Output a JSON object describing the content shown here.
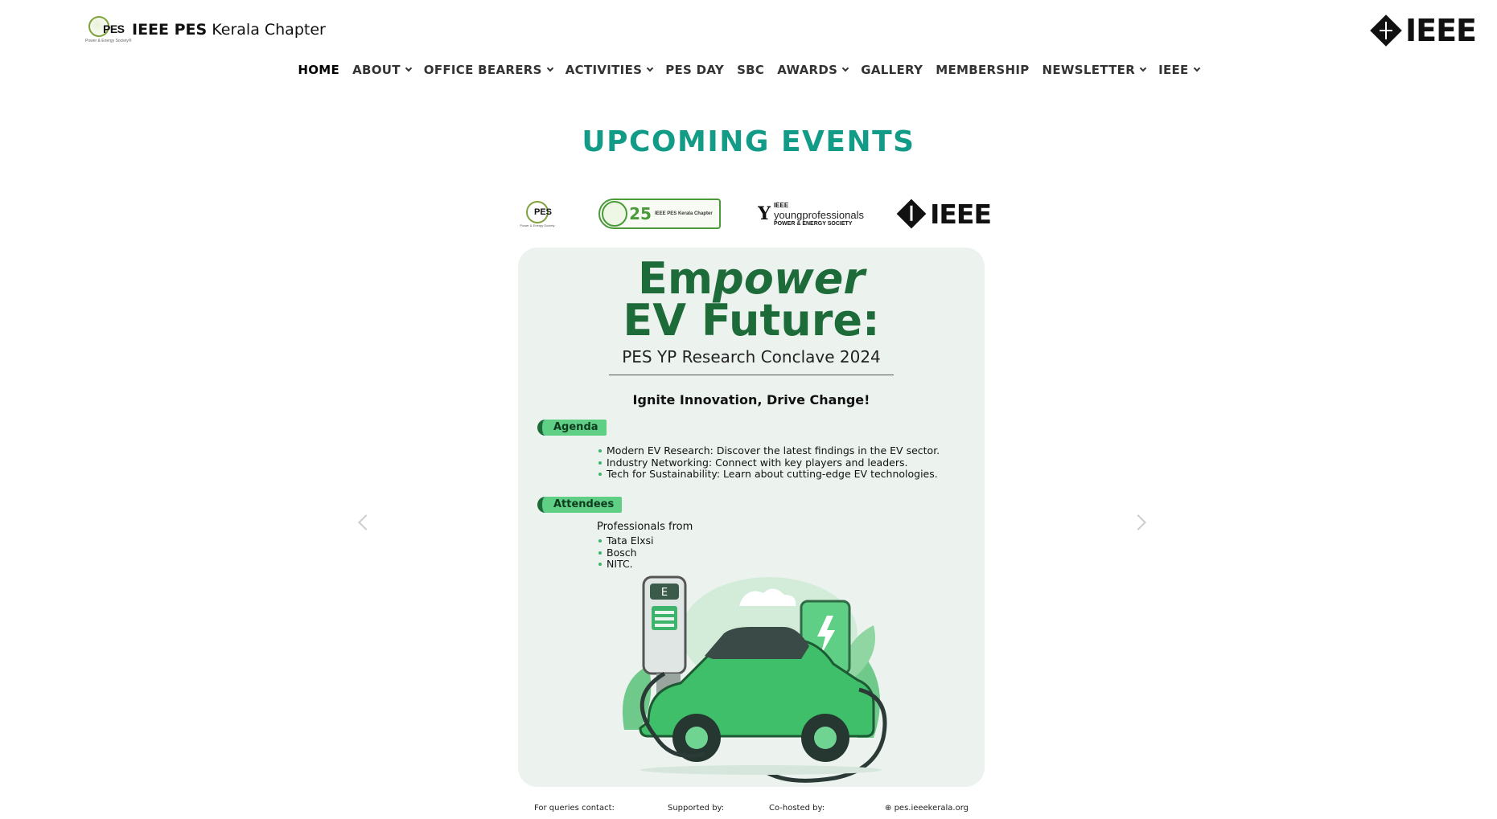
{
  "header": {
    "site_title_bold": "IEEE PES",
    "site_title_rest": " Kerala Chapter",
    "logo_mark_text": "PES",
    "logo_mark_tagline": "Power & Energy Society®",
    "brand_word": "IEEE"
  },
  "nav": {
    "items": [
      {
        "label": "HOME",
        "dropdown": false
      },
      {
        "label": "ABOUT",
        "dropdown": true
      },
      {
        "label": "OFFICE BEARERS",
        "dropdown": true
      },
      {
        "label": "ACTIVITIES",
        "dropdown": true
      },
      {
        "label": "PES DAY",
        "dropdown": false
      },
      {
        "label": "SBC",
        "dropdown": false
      },
      {
        "label": "AWARDS",
        "dropdown": true
      },
      {
        "label": "GALLERY",
        "dropdown": false
      },
      {
        "label": "MEMBERSHIP",
        "dropdown": false
      },
      {
        "label": "NEWSLETTER",
        "dropdown": true
      },
      {
        "label": "IEEE",
        "dropdown": true
      }
    ]
  },
  "main": {
    "section_title": "UPCOMING EVENTS"
  },
  "poster": {
    "logos": {
      "pes_text": "PES",
      "pes_tag": "Power & Energy Society",
      "anniv_number": "25",
      "anniv_text": "IEEE PES Kerala Chapter",
      "yp_top": "IEEE",
      "yp_mid": "youngprofessionals",
      "yp_bottom": "POWER & ENERGY SOCIETY",
      "ieee_word": "IEEE"
    },
    "headline_em": "Em",
    "headline_power": "power",
    "headline_line2": "EV Future:",
    "subtitle": "PES YP Research Conclave 2024",
    "tagline": "Ignite Innovation, Drive Change!",
    "agenda_label": "Agenda",
    "agenda_items": [
      "Modern EV Research: Discover the latest findings in the EV sector.",
      "Industry Networking: Connect with key players and leaders.",
      "Tech for Sustainability: Learn about cutting-edge EV technologies."
    ],
    "attendees_label": "Attendees",
    "attendees_intro": "Professionals from",
    "attendees_items": [
      "Tata Elxsi",
      "Bosch",
      "NITC."
    ],
    "charger_letter": "E",
    "footer": {
      "queries": "For queries contact:",
      "supported": "Supported by:",
      "cohosted": "Co-hosted by:",
      "website": "pes.ieeekerala.org"
    }
  },
  "colors": {
    "accent_teal": "#129b86",
    "poster_green": "#1e6b3a",
    "poster_bg": "#ecf3ef",
    "pill_green": "#5fcf86"
  }
}
